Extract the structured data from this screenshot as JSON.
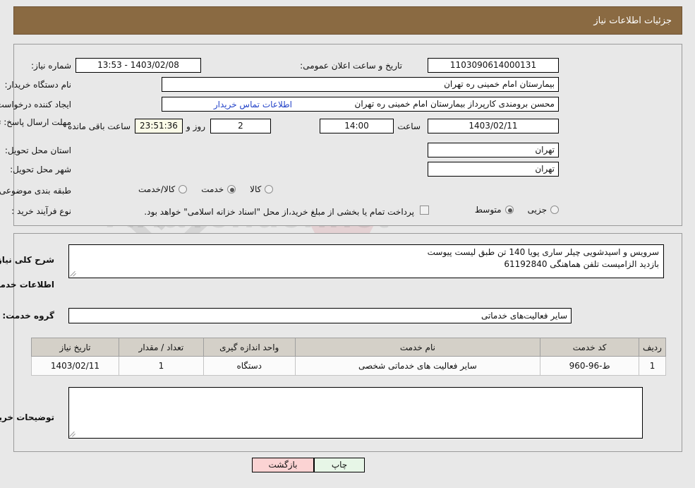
{
  "header": {
    "title": "جزئیات اطلاعات نیاز"
  },
  "top": {
    "need_number_label": "شماره نیاز:",
    "need_number_value": "1103090614000131",
    "public_announce_label": "تاریخ و ساعت اعلان عمومی:",
    "public_announce_value": "1403/02/08 - 13:53",
    "buyer_org_label": "نام دستگاه خریدار:",
    "buyer_org_value": "بیمارستان امام خمینی ره  تهران",
    "requester_label": "ایجاد کننده درخواست:",
    "requester_value": "محسن برومندی کارپرداز بیمارستان امام خمینی ره  تهران",
    "contact_link": "اطلاعات تماس خریدار",
    "deadline_label": "مهلت ارسال پاسخ: تا تاریخ:",
    "deadline_date": "1403/02/11",
    "hour_label": "ساعت",
    "deadline_time": "14:00",
    "days_value": "2",
    "days_label": "روز و",
    "countdown_value": "23:51:36",
    "countdown_label": "ساعت باقی مانده",
    "province_label": "استان محل تحویل:",
    "province_value": "تهران",
    "city_label": "شهر محل تحویل:",
    "city_value": "تهران",
    "category_label": "طبقه بندی موضوعی:",
    "category_options": [
      {
        "label": "کالا",
        "selected": false
      },
      {
        "label": "خدمت",
        "selected": true
      },
      {
        "label": "کالا/خدمت",
        "selected": false
      }
    ],
    "process_label": "نوع فرآیند خرید :",
    "process_options": [
      {
        "label": "جزیی",
        "selected": false
      },
      {
        "label": "متوسط",
        "selected": true
      }
    ],
    "treasury_checked": false,
    "treasury_label": "پرداخت تمام یا بخشی از مبلغ خرید،از محل \"اسناد خزانه اسلامی\" خواهد بود."
  },
  "mid": {
    "summary_label": "شرح کلی نیاز:",
    "summary_line1": "سرویس و اسیدشویی چیلر ساری پویا 140 تن طبق لیست پیوست",
    "summary_line2": "بازدید الزامیست تلفن هماهنگی 61192840",
    "services_title": "اطلاعات خدمات مورد نیاز",
    "service_group_label": "گروه خدمت:",
    "service_group_value": "سایر فعالیت‌های خدماتی",
    "table": {
      "headers": [
        "ردیف",
        "کد خدمت",
        "نام خدمت",
        "واحد اندازه گیری",
        "تعداد / مقدار",
        "تاریخ نیاز"
      ],
      "rows": [
        [
          "1",
          "ط-96-960",
          "سایر فعالیت های خدماتی شخصی",
          "دستگاه",
          "1",
          "1403/02/11"
        ]
      ]
    },
    "buyer_notes_label": "توضیحات خریدار:",
    "buyer_notes_value": ""
  },
  "footer": {
    "print_button": "چاپ",
    "back_button": "بازگشت"
  },
  "watermark": {
    "text": "AriaTender.net"
  },
  "colors": {
    "header_bg": "#8a6a42",
    "link": "#2343c8",
    "print_bg": "#e7f6e7",
    "back_bg": "#fbd3d3",
    "table_header_bg": "#d4d0c8",
    "countdown_bg": "#fbfbe8"
  }
}
